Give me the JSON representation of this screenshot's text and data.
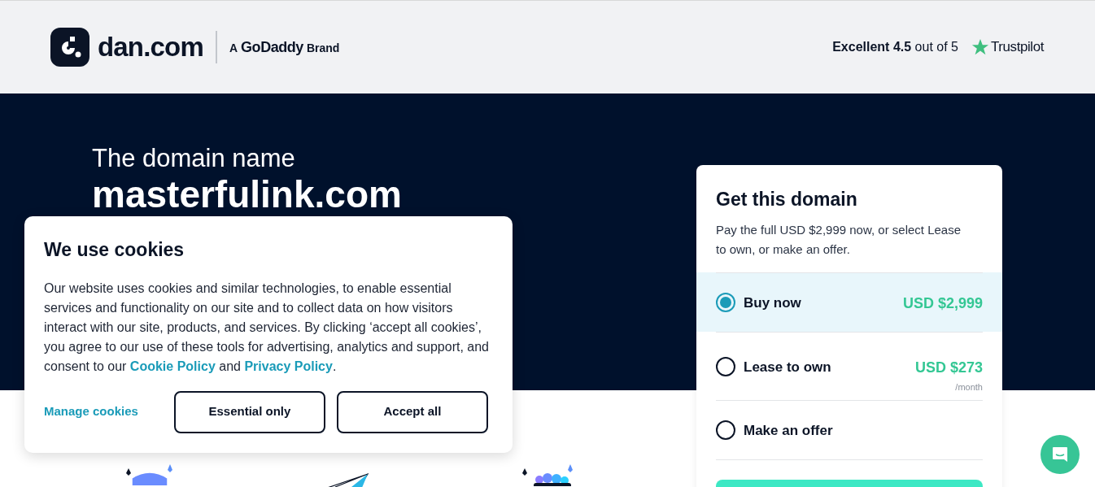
{
  "header": {
    "logo_text": "dan.com",
    "brand_prefix": "A",
    "brand_name": "GoDaddy",
    "brand_suffix": "Brand",
    "rating_label": "Excellent 4.5",
    "rating_scale": "out of 5",
    "review_site": "Trustpilot"
  },
  "hero": {
    "intro": "The domain name",
    "domain": "masterfulink.com"
  },
  "purchase_card": {
    "title": "Get this domain",
    "description": "Pay the full USD $2,999 now, or select Lease to own, or make an offer.",
    "options": [
      {
        "label": "Buy now",
        "price": "USD $2,999",
        "selected": true
      },
      {
        "label": "Lease to own",
        "price": "USD $273",
        "period": "/month",
        "selected": false
      },
      {
        "label": "Make an offer",
        "selected": false
      }
    ]
  },
  "cookie_dialog": {
    "title": "We use cookies",
    "text": "Our website uses cookies and similar technologies, to enable essential services and functionality on our site and to collect data on how visitors interact with our site, products, and services. By clicking ‘accept all cookies’, you agree to our use of these tools for advertising, analytics and support, and consent to our",
    "link_1": "Cookie Policy",
    "joiner": "and",
    "link_2": "Privacy Policy",
    "end": ".",
    "manage_link": "Manage cookies",
    "buttons": [
      "Essential only",
      "Accept all"
    ]
  }
}
